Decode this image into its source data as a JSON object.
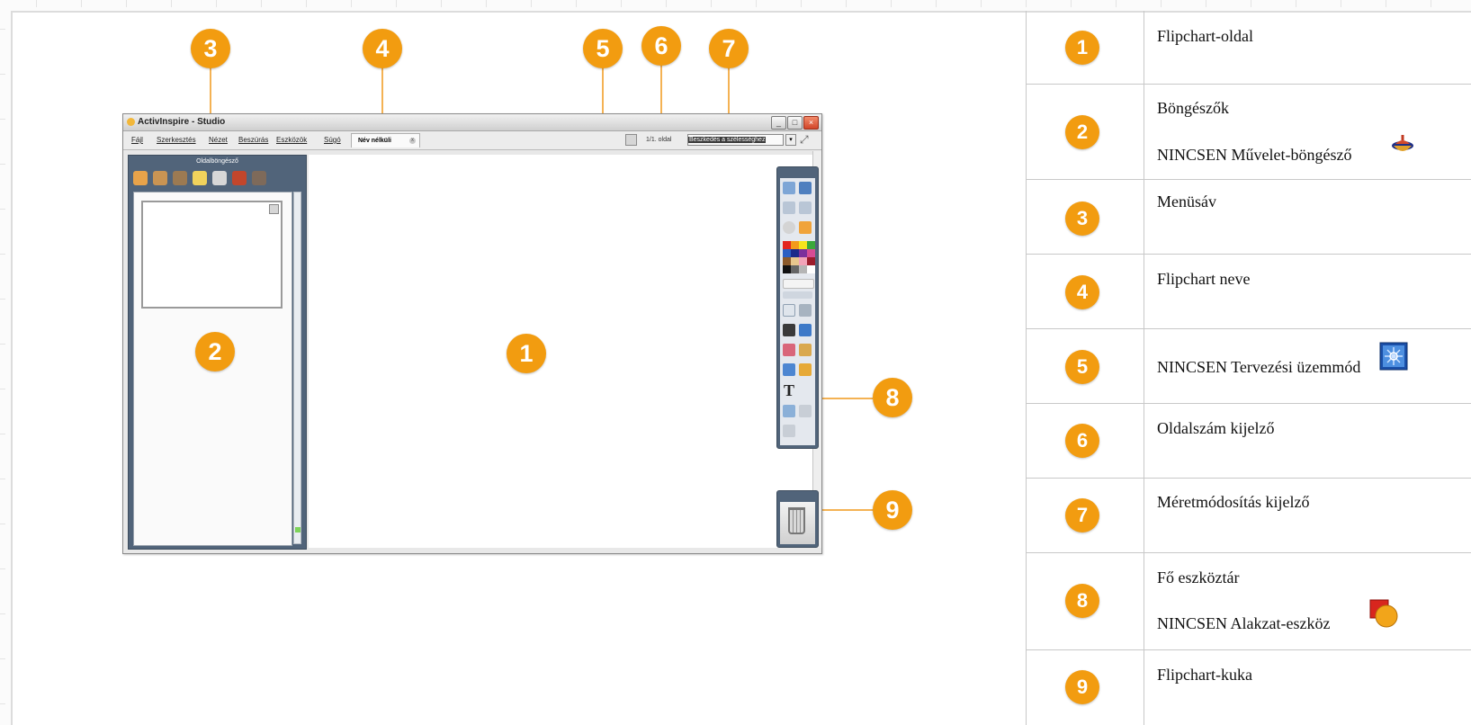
{
  "window": {
    "title": "ActivInspire - Studio",
    "menu": [
      "Fájl",
      "Szerkesztés",
      "Nézet",
      "Beszúrás",
      "Eszközök",
      "Súgó"
    ],
    "flipchart_tab": "Név nélküli",
    "page_indicator": "1/1. oldal",
    "resize_value": "Beszkedés a szélességhez",
    "page_browser_title": "Oldalböngésző",
    "controls": {
      "minimize": "_",
      "maximize": "□",
      "close": "×",
      "dropdown": "▾",
      "fullscreen": "⤢"
    }
  },
  "callouts": {
    "c1": "1",
    "c2": "2",
    "c3": "3",
    "c4": "4",
    "c5": "5",
    "c6": "6",
    "c7": "7",
    "c8": "8",
    "c9": "9"
  },
  "toolbox_text_glyph": "T",
  "legend": [
    {
      "num": "1",
      "lines": [
        "Flipchart-oldal"
      ]
    },
    {
      "num": "2",
      "lines": [
        "Böngészők",
        "NINCSEN Művelet-böngésző"
      ],
      "icon": "action-browser-icon"
    },
    {
      "num": "3",
      "lines": [
        "Menüsáv"
      ]
    },
    {
      "num": "4",
      "lines": [
        "Flipchart neve"
      ]
    },
    {
      "num": "5",
      "lines": [
        "NINCSEN Tervezési üzemmód"
      ],
      "icon": "design-mode-icon"
    },
    {
      "num": "6",
      "lines": [
        "Oldalszám kijelző"
      ]
    },
    {
      "num": "7",
      "lines": [
        "Méretmódosítás kijelző"
      ]
    },
    {
      "num": "8",
      "lines": [
        "Fő eszköztár",
        "NINCSEN Alakzat-eszköz"
      ],
      "icon": "shape-tool-icon"
    },
    {
      "num": "9",
      "lines": [
        "Flipchart-kuka"
      ]
    }
  ],
  "colors": {
    "callout": "#f29c10",
    "browser_frame": "#51647a"
  }
}
